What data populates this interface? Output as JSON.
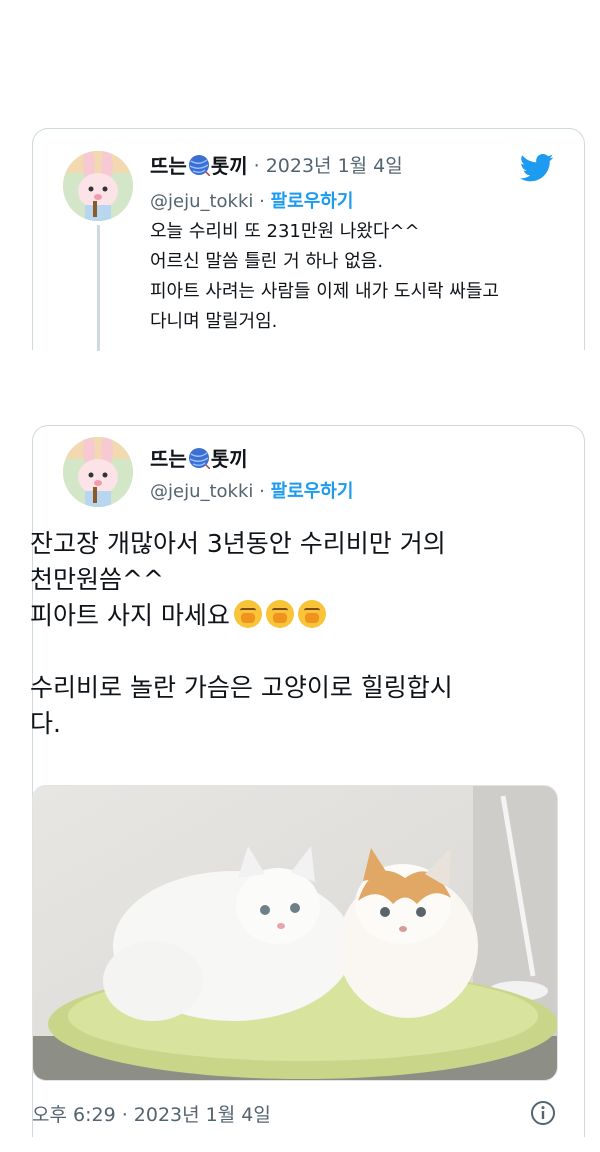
{
  "tweet1": {
    "display_name_prefix": "뜨는",
    "display_name_suffix": "톳끼",
    "date": "· 2023년 1월 4일",
    "handle": "@jeju_tokki",
    "separator": " · ",
    "follow_label": "팔로우하기",
    "lines": [
      "오늘 수리비 또 231만원 나왔다^^",
      "어르신 말씀 틀린 거 하나 없음.",
      "피아트 사려는 사람들 이제 내가 도시락 싸들고",
      "다니며 말릴거임."
    ],
    "icons": {
      "avatar": "bunny-avatar",
      "yarn": "yarn-ball-icon",
      "brand": "twitter-bird-icon"
    }
  },
  "tweet2": {
    "display_name_prefix": "뜨는",
    "display_name_suffix": "톳끼",
    "handle": "@jeju_tokki",
    "separator": " · ",
    "follow_label": "팔로우하기",
    "line1": "잔고장 개많아서 3년동안 수리비만 거의",
    "line2": "천만원씀^^",
    "line3": "피아트 사지 마세요",
    "line4": "수리비로 놀란 가슴은 고양이로 힐링합시",
    "line5": "다.",
    "emoji": "face-with-hand-over-mouth",
    "photo": "two-fluffy-cats-on-green-cushion",
    "timestamp": "오후 6:29 · 2023년 1월 4일",
    "icons": {
      "info": "info-icon"
    }
  },
  "colors": {
    "accent": "#1d9bf0",
    "text": "#0f1419",
    "muted": "#536471",
    "border": "#cfd9de"
  }
}
